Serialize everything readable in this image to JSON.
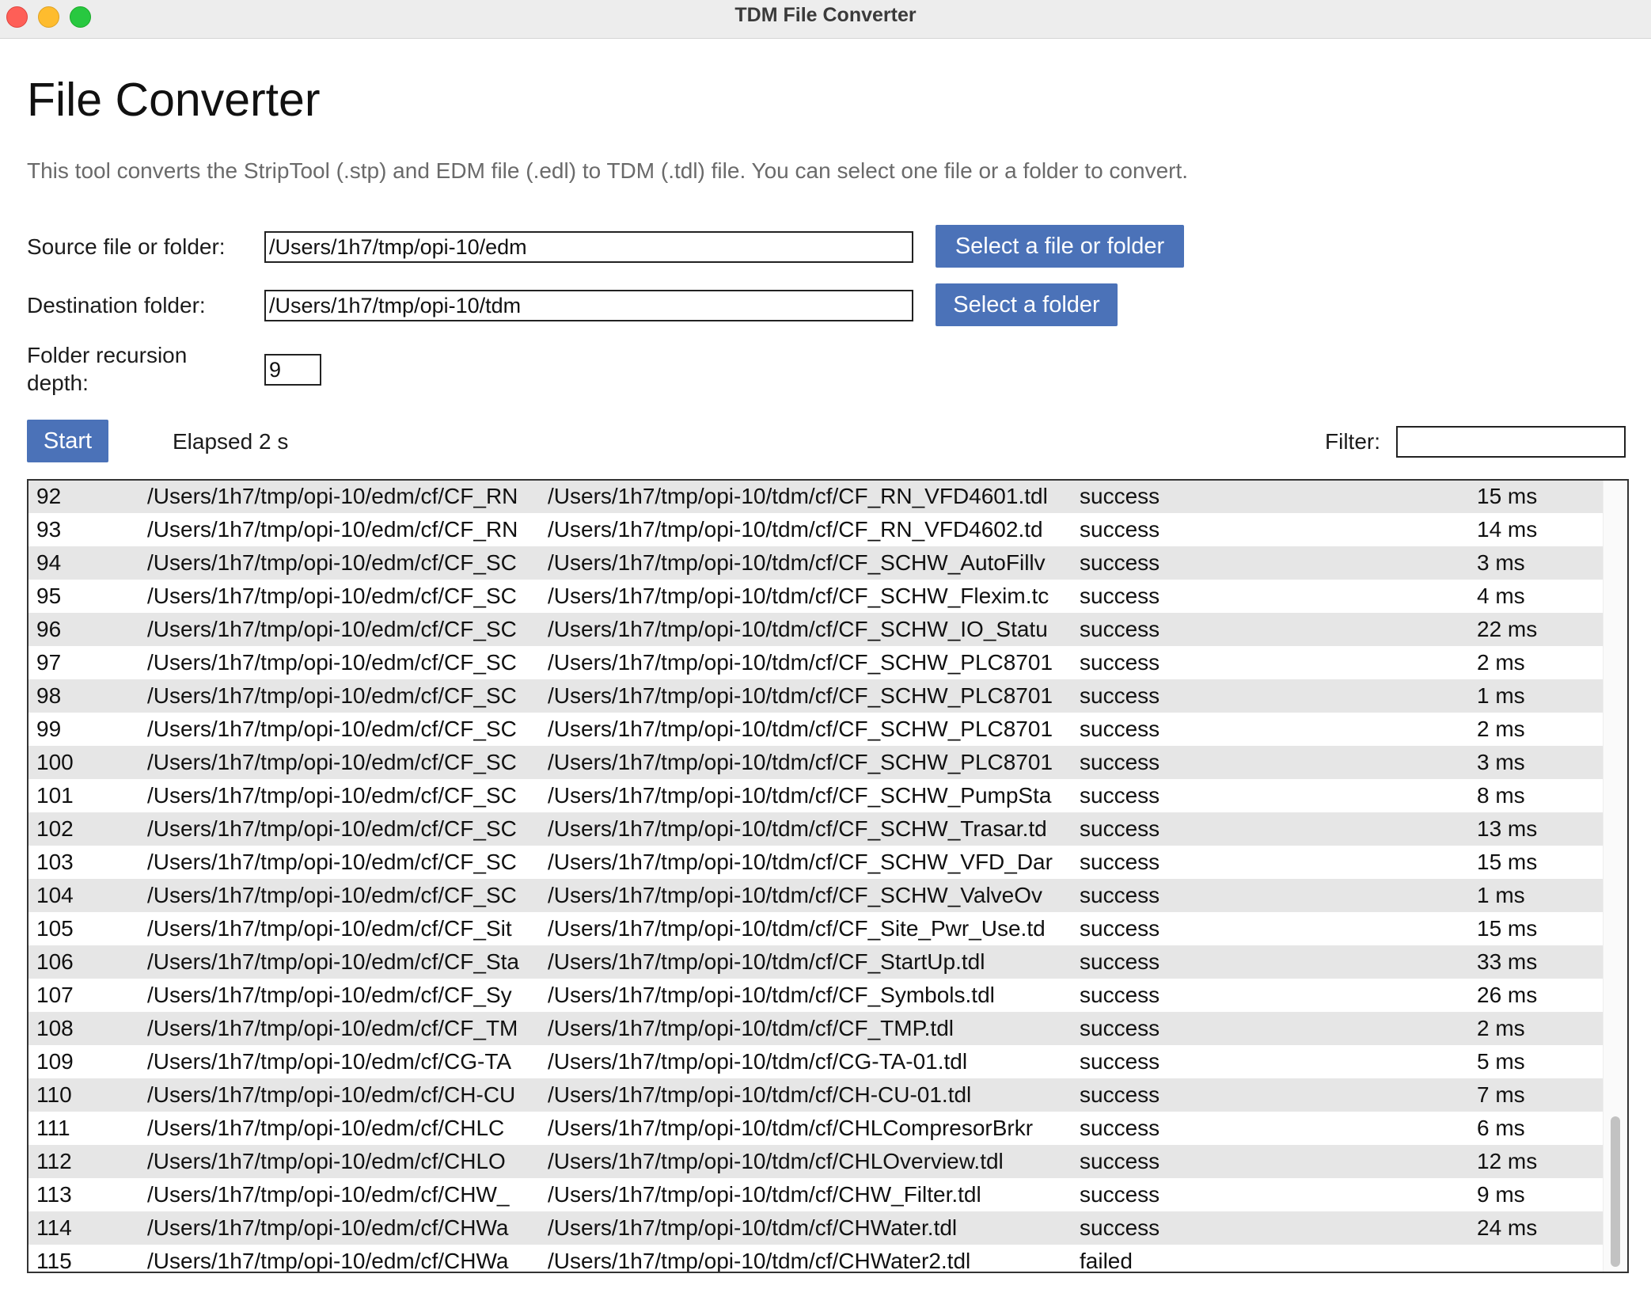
{
  "window": {
    "title": "TDM File Converter"
  },
  "page": {
    "heading": "File Converter",
    "description": "This tool converts the StripTool (.stp) and EDM file (.edl) to TDM (.tdl) file. You can select one file or a folder to convert."
  },
  "form": {
    "source_label": "Source file or folder:",
    "source_value": "/Users/1h7/tmp/opi-10/edm",
    "source_button": "Select a file or folder",
    "dest_label": "Destination folder:",
    "dest_value": "/Users/1h7/tmp/opi-10/tdm",
    "dest_button": "Select a folder",
    "depth_label_line1": "Folder recursion",
    "depth_label_line2": "depth:",
    "depth_value": "9"
  },
  "controls": {
    "start_label": "Start",
    "elapsed_text": "Elapsed 2 s",
    "filter_label": "Filter:",
    "filter_value": ""
  },
  "results": [
    {
      "n": "92",
      "src": "/Users/1h7/tmp/opi-10/edm/cf/CF_RN",
      "dst": "/Users/1h7/tmp/opi-10/tdm/cf/CF_RN_VFD4601.tdl",
      "status": "success",
      "time": "15 ms"
    },
    {
      "n": "93",
      "src": "/Users/1h7/tmp/opi-10/edm/cf/CF_RN",
      "dst": "/Users/1h7/tmp/opi-10/tdm/cf/CF_RN_VFD4602.td",
      "status": "success",
      "time": "14 ms"
    },
    {
      "n": "94",
      "src": "/Users/1h7/tmp/opi-10/edm/cf/CF_SC",
      "dst": "/Users/1h7/tmp/opi-10/tdm/cf/CF_SCHW_AutoFillv",
      "status": "success",
      "time": "3 ms"
    },
    {
      "n": "95",
      "src": "/Users/1h7/tmp/opi-10/edm/cf/CF_SC",
      "dst": "/Users/1h7/tmp/opi-10/tdm/cf/CF_SCHW_Flexim.tc",
      "status": "success",
      "time": "4 ms"
    },
    {
      "n": "96",
      "src": "/Users/1h7/tmp/opi-10/edm/cf/CF_SC",
      "dst": "/Users/1h7/tmp/opi-10/tdm/cf/CF_SCHW_IO_Statu",
      "status": "success",
      "time": "22 ms"
    },
    {
      "n": "97",
      "src": "/Users/1h7/tmp/opi-10/edm/cf/CF_SC",
      "dst": "/Users/1h7/tmp/opi-10/tdm/cf/CF_SCHW_PLC8701",
      "status": "success",
      "time": "2 ms"
    },
    {
      "n": "98",
      "src": "/Users/1h7/tmp/opi-10/edm/cf/CF_SC",
      "dst": "/Users/1h7/tmp/opi-10/tdm/cf/CF_SCHW_PLC8701",
      "status": "success",
      "time": "1 ms"
    },
    {
      "n": "99",
      "src": "/Users/1h7/tmp/opi-10/edm/cf/CF_SC",
      "dst": "/Users/1h7/tmp/opi-10/tdm/cf/CF_SCHW_PLC8701",
      "status": "success",
      "time": "2 ms"
    },
    {
      "n": "100",
      "src": "/Users/1h7/tmp/opi-10/edm/cf/CF_SC",
      "dst": "/Users/1h7/tmp/opi-10/tdm/cf/CF_SCHW_PLC8701",
      "status": "success",
      "time": "3 ms"
    },
    {
      "n": "101",
      "src": "/Users/1h7/tmp/opi-10/edm/cf/CF_SC",
      "dst": "/Users/1h7/tmp/opi-10/tdm/cf/CF_SCHW_PumpSta",
      "status": "success",
      "time": "8 ms"
    },
    {
      "n": "102",
      "src": "/Users/1h7/tmp/opi-10/edm/cf/CF_SC",
      "dst": "/Users/1h7/tmp/opi-10/tdm/cf/CF_SCHW_Trasar.td",
      "status": "success",
      "time": "13 ms"
    },
    {
      "n": "103",
      "src": "/Users/1h7/tmp/opi-10/edm/cf/CF_SC",
      "dst": "/Users/1h7/tmp/opi-10/tdm/cf/CF_SCHW_VFD_Dar",
      "status": "success",
      "time": "15 ms"
    },
    {
      "n": "104",
      "src": "/Users/1h7/tmp/opi-10/edm/cf/CF_SC",
      "dst": "/Users/1h7/tmp/opi-10/tdm/cf/CF_SCHW_ValveOv",
      "status": "success",
      "time": "1 ms"
    },
    {
      "n": "105",
      "src": "/Users/1h7/tmp/opi-10/edm/cf/CF_Sit",
      "dst": "/Users/1h7/tmp/opi-10/tdm/cf/CF_Site_Pwr_Use.td",
      "status": "success",
      "time": "15 ms"
    },
    {
      "n": "106",
      "src": "/Users/1h7/tmp/opi-10/edm/cf/CF_Sta",
      "dst": "/Users/1h7/tmp/opi-10/tdm/cf/CF_StartUp.tdl",
      "status": "success",
      "time": "33 ms"
    },
    {
      "n": "107",
      "src": "/Users/1h7/tmp/opi-10/edm/cf/CF_Sy",
      "dst": "/Users/1h7/tmp/opi-10/tdm/cf/CF_Symbols.tdl",
      "status": "success",
      "time": "26 ms"
    },
    {
      "n": "108",
      "src": "/Users/1h7/tmp/opi-10/edm/cf/CF_TM",
      "dst": "/Users/1h7/tmp/opi-10/tdm/cf/CF_TMP.tdl",
      "status": "success",
      "time": "2 ms"
    },
    {
      "n": "109",
      "src": "/Users/1h7/tmp/opi-10/edm/cf/CG-TA",
      "dst": "/Users/1h7/tmp/opi-10/tdm/cf/CG-TA-01.tdl",
      "status": "success",
      "time": "5 ms"
    },
    {
      "n": "110",
      "src": "/Users/1h7/tmp/opi-10/edm/cf/CH-CU",
      "dst": "/Users/1h7/tmp/opi-10/tdm/cf/CH-CU-01.tdl",
      "status": "success",
      "time": "7 ms"
    },
    {
      "n": "111",
      "src": "/Users/1h7/tmp/opi-10/edm/cf/CHLC",
      "dst": "/Users/1h7/tmp/opi-10/tdm/cf/CHLCompresorBrkr",
      "status": "success",
      "time": "6 ms"
    },
    {
      "n": "112",
      "src": "/Users/1h7/tmp/opi-10/edm/cf/CHLO",
      "dst": "/Users/1h7/tmp/opi-10/tdm/cf/CHLOverview.tdl",
      "status": "success",
      "time": "12 ms"
    },
    {
      "n": "113",
      "src": "/Users/1h7/tmp/opi-10/edm/cf/CHW_",
      "dst": "/Users/1h7/tmp/opi-10/tdm/cf/CHW_Filter.tdl",
      "status": "success",
      "time": "9 ms"
    },
    {
      "n": "114",
      "src": "/Users/1h7/tmp/opi-10/edm/cf/CHWa",
      "dst": "/Users/1h7/tmp/opi-10/tdm/cf/CHWater.tdl",
      "status": "success",
      "time": "24 ms"
    },
    {
      "n": "115",
      "src": "/Users/1h7/tmp/opi-10/edm/cf/CHWa",
      "dst": "/Users/1h7/tmp/opi-10/tdm/cf/CHWater2.tdl",
      "status": "failed",
      "time": ""
    }
  ]
}
